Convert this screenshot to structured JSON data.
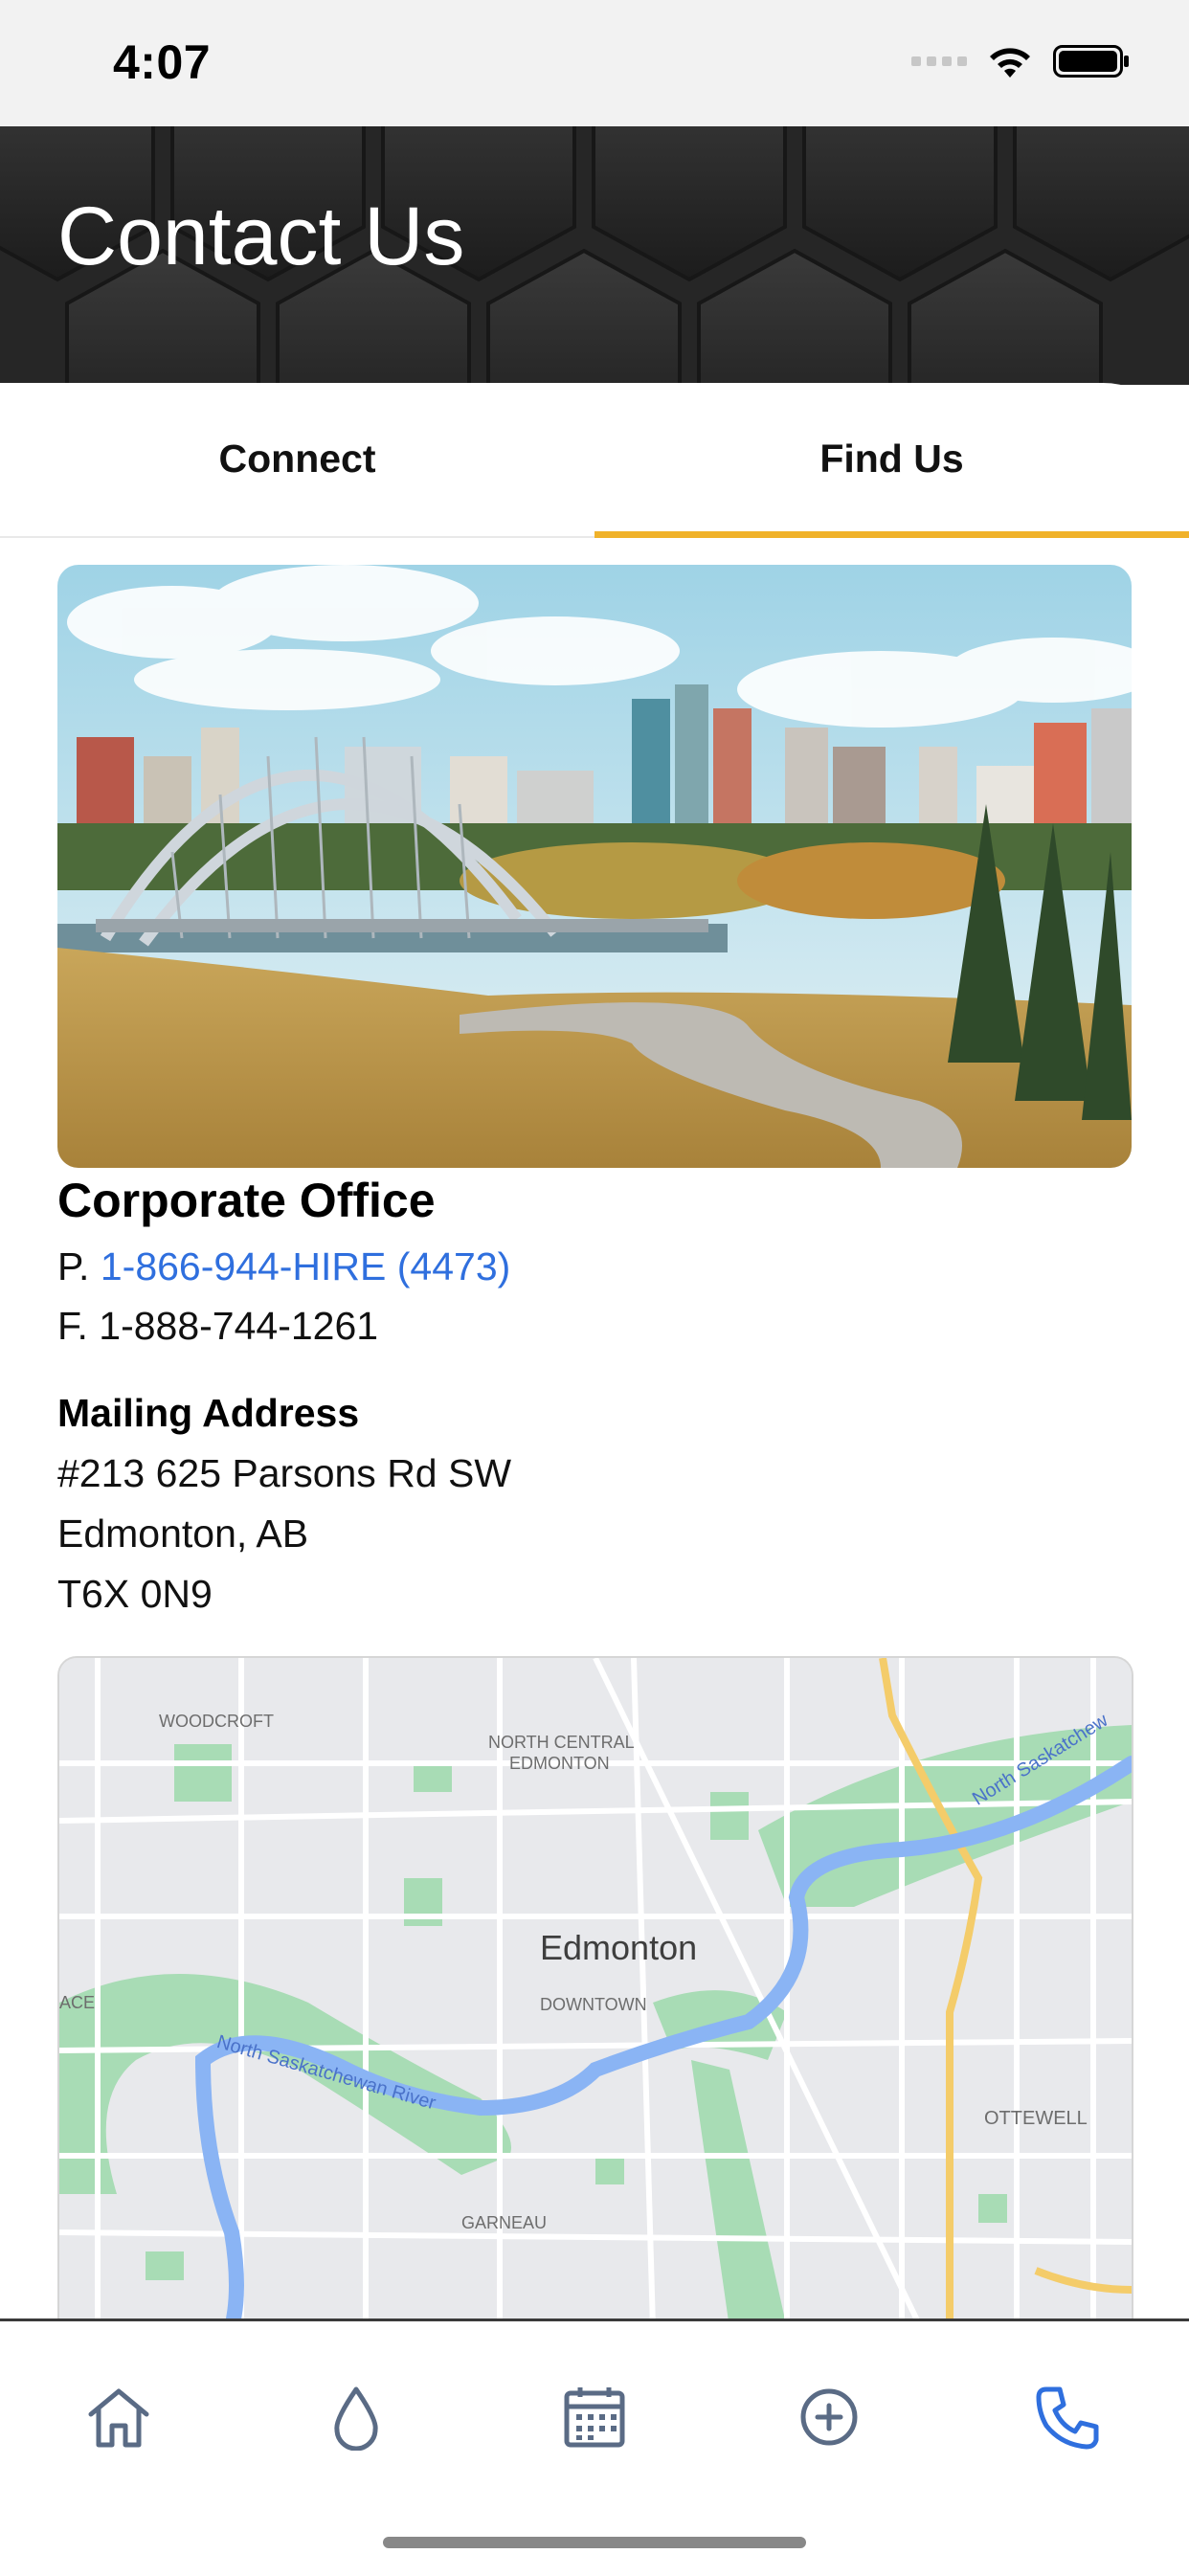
{
  "status_bar": {
    "time": "4:07",
    "icons": [
      "cellular-signal-icon",
      "wifi-icon",
      "battery-icon"
    ]
  },
  "header": {
    "title": "Contact Us"
  },
  "tabs": [
    {
      "label": "Connect",
      "active": false
    },
    {
      "label": "Find Us",
      "active": true
    }
  ],
  "accent_color": "#f0b22a",
  "link_color": "#2f6fde",
  "corporate_office": {
    "title": "Corporate Office",
    "phone_prefix": "P.",
    "phone": "1-866-944-HIRE (4473)",
    "fax": "F. 1-888-744-1261"
  },
  "mailing_address": {
    "heading": "Mailing Address",
    "line1": "#213 625 Parsons Rd SW",
    "line2": "Edmonton, AB",
    "line3": "T6X 0N9"
  },
  "map": {
    "labels": {
      "woodcroft": "WOODCROFT",
      "north_central_1": "NORTH CENTRAL",
      "north_central_2": "EDMONTON",
      "city": "Edmonton",
      "downtown": "DOWNTOWN",
      "river_west": "North Saskatchewan River",
      "river_east": "North Saskatchew",
      "ottewell": "OTTEWELL",
      "garneau": "GARNEAU",
      "edge_left": "ACE"
    }
  },
  "bottom_nav": [
    {
      "icon": "home-icon",
      "active": false
    },
    {
      "icon": "water-drop-icon",
      "active": false
    },
    {
      "icon": "calendar-icon",
      "active": false
    },
    {
      "icon": "add-circle-icon",
      "active": false
    },
    {
      "icon": "phone-icon",
      "active": true
    }
  ]
}
